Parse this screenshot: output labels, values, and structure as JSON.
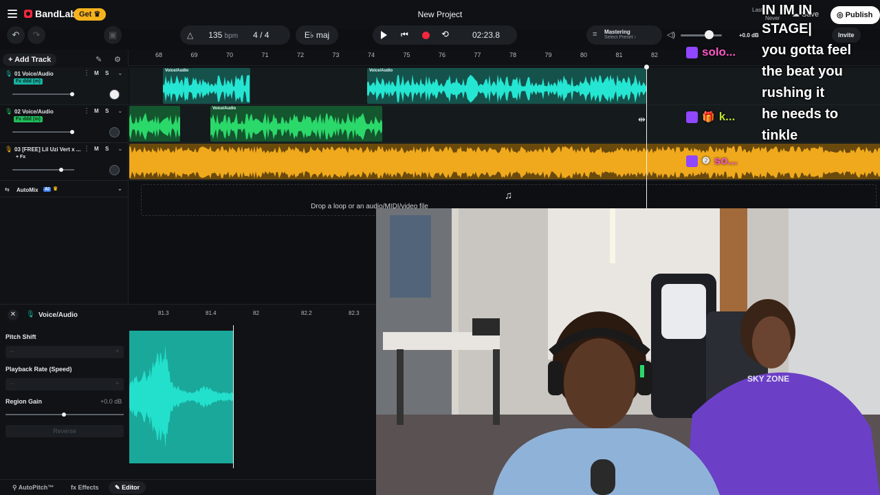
{
  "app": {
    "brand": "BandLab",
    "get_label": "Get",
    "project_title": "New Project",
    "last_saved_label": "Last",
    "last_saved_value": "Never",
    "save_label": "Save",
    "publish_label": "Publish",
    "invite_label": "Invite"
  },
  "transport": {
    "tempo": "135",
    "tempo_unit": "bpm",
    "time_sig_num": "4",
    "time_sig_sep": "/",
    "time_sig_den": "4",
    "key": "E♭ maj",
    "time": "02:23.8",
    "mastering_title": "Mastering",
    "mastering_sub": "Select Preset ›",
    "master_gain": "+0.0 dB"
  },
  "sidebar": {
    "add_track_label": "Add Track",
    "tracks": [
      {
        "name": "01  Voice/Audio",
        "fx": "Fx  ddd (m)",
        "m": "M",
        "s": "S"
      },
      {
        "name": "02  Voice/Audio",
        "fx": "Fx  ddd (m)",
        "m": "M",
        "s": "S"
      },
      {
        "name": "03  [FREE] Lil Uzi Vert x ...",
        "fx": "+ Fx",
        "m": "M",
        "s": "S"
      }
    ],
    "automix_label": "AutoMix",
    "automix_badge": "AI"
  },
  "timeline": {
    "bars": [
      "68",
      "69",
      "70",
      "71",
      "72",
      "73",
      "74",
      "75",
      "76",
      "77",
      "78",
      "79",
      "80",
      "81",
      "82"
    ],
    "clip_label": "Voice/Audio",
    "drop_text": "Drop a loop or an audio/MIDI/video file",
    "colors": {
      "track1": "#18b2a2",
      "track2": "#1fbf5a",
      "track3": "#f0a91c"
    }
  },
  "editor": {
    "title": "Voice/Audio",
    "ruler": [
      "81.3",
      "81.4",
      "82",
      "82.2",
      "82.3"
    ],
    "pitch_shift_label": "Pitch Shift",
    "playback_rate_label": "Playback Rate (Speed)",
    "region_gain_label": "Region Gain",
    "region_gain_value": "+0.0 dB",
    "reverse_label": "Reverse",
    "tabs": {
      "autopitch": "AutoPitch™",
      "effects": "Effects",
      "editor": "Editor"
    }
  },
  "overlay": {
    "chat_lines": [
      "IN IM IN",
      "STAGE|",
      "you gotta feel",
      "the beat you",
      "rushing it",
      "he needs to",
      "tinkle"
    ],
    "tw_names": [
      "solo...",
      "k...",
      "so..."
    ],
    "sky_zone": "SKY ZONE"
  }
}
